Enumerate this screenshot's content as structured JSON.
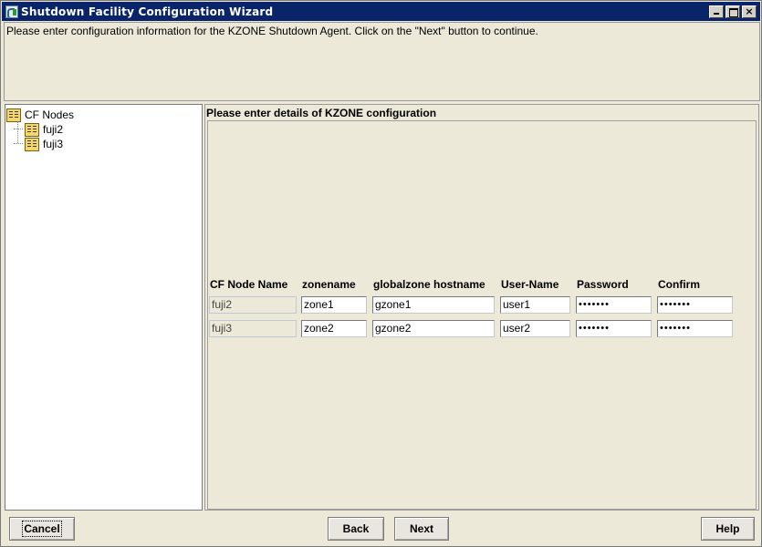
{
  "window": {
    "title": "Shutdown Facility Configuration Wizard",
    "controls": [
      "_",
      "□",
      "×"
    ]
  },
  "instructions": {
    "text": "Please enter configuration information for the KZONE Shutdown Agent. Click on the \"Next\" button to continue."
  },
  "tree": {
    "root": "CF Nodes",
    "children": [
      "fuji2",
      "fuji3"
    ],
    "icon": "server-node-icon"
  },
  "form": {
    "title": "Please enter details of KZONE configuration",
    "headers": {
      "node": "CF Node Name",
      "zone": "zonename",
      "global": "globalzone hostname",
      "user": "User-Name",
      "password": "Password",
      "confirm": "Confirm"
    },
    "rows": [
      {
        "node": "fuji2",
        "zone": "zone1",
        "global": "gzone1",
        "user": "user1",
        "password": "•••••••",
        "confirm": "•••••••"
      },
      {
        "node": "fuji3",
        "zone": "zone2",
        "global": "gzone2",
        "user": "user2",
        "password": "•••••••",
        "confirm": "•••••••"
      }
    ]
  },
  "buttons": {
    "cancel": "Cancel",
    "back": "Back",
    "next": "Next",
    "help": "Help"
  }
}
